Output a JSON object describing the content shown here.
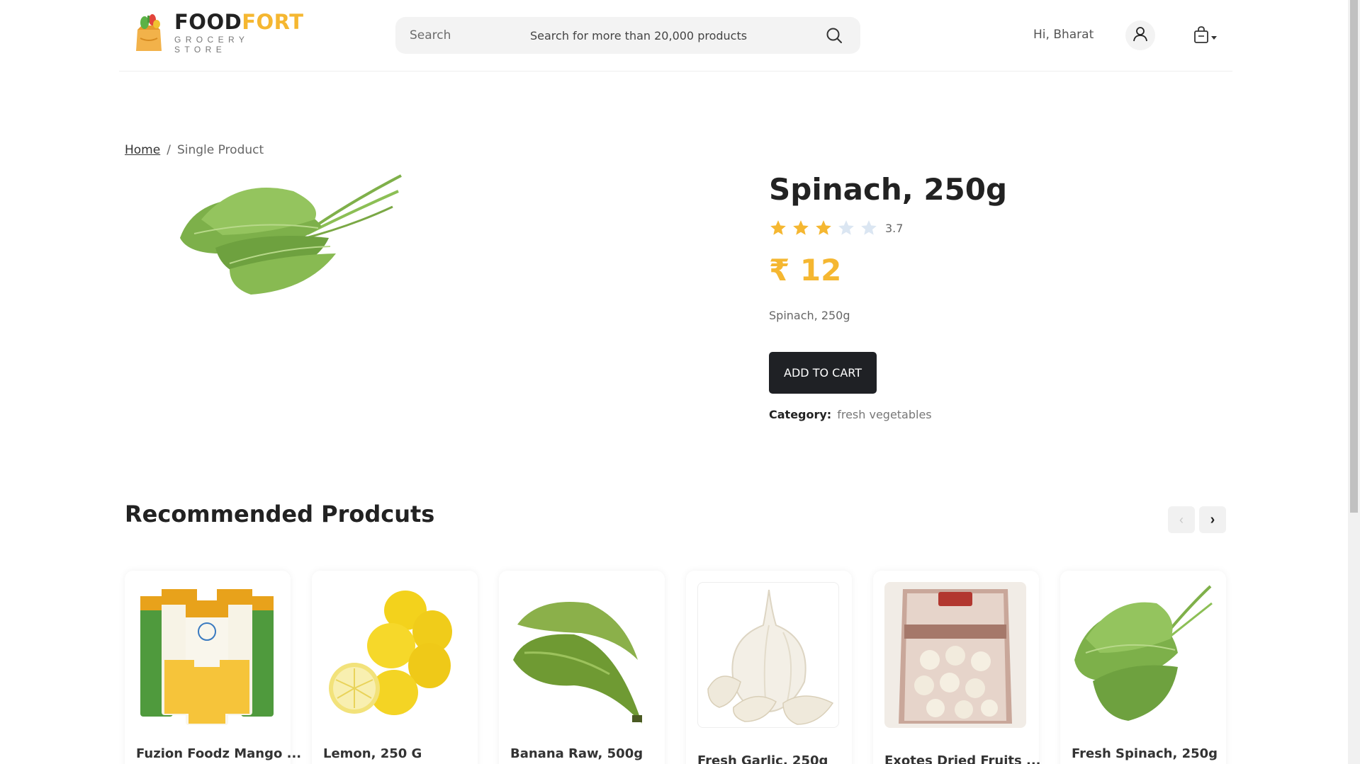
{
  "header": {
    "logo": {
      "food": "FOOD",
      "fort": "FORT",
      "tagline": "GROCERY STORE"
    },
    "search": {
      "label": "Search",
      "placeholder": "Search for more than 20,000 products",
      "icon": "search-icon"
    },
    "greeting": "Hi, Bharat",
    "user_icon": "user-icon",
    "cart_icon": "shopping-bag-icon"
  },
  "breadcrumb": {
    "home": "Home",
    "separator": "/",
    "current": "Single Product"
  },
  "product": {
    "title": "Spinach, 250g",
    "rating": 3.7,
    "rating_text": "3.7",
    "stars_total": 5,
    "price": "₹ 12",
    "description": "Spinach, 250g",
    "add_to_cart": "ADD TO CART",
    "category_label": "Category:",
    "category_value": "fresh vegetables"
  },
  "colors": {
    "accent": "#f5b731",
    "dark": "#1f2125",
    "star_empty": "#dbe6f2"
  },
  "recommended": {
    "title": "Recommended Prodcuts",
    "prev_icon": "chevron-left-icon",
    "next_icon": "chevron-right-icon",
    "items": [
      {
        "name": "Fuzion Foodz Mango ...",
        "image": "mango-slices-jars"
      },
      {
        "name": "Lemon, 250 G",
        "image": "lemons"
      },
      {
        "name": "Banana Raw, 500g",
        "image": "raw-bananas"
      },
      {
        "name": "Fresh Garlic, 250g",
        "image": "garlic"
      },
      {
        "name": "Exotes Dried Fruits ...",
        "image": "makhana-pouch"
      },
      {
        "name": "Fresh Spinach, 250g",
        "image": "spinach"
      }
    ]
  }
}
